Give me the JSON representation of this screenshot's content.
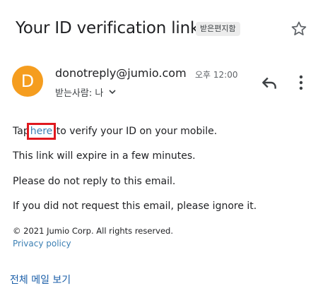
{
  "email": {
    "subject": "Your ID verification link",
    "label_badge": "받은편지함",
    "sender": "donotreply@jumio.com",
    "time": "오후 12:00",
    "avatar_letter": "D",
    "recipient": "받는사람: 나",
    "body": {
      "tap": "Tap",
      "here": "here",
      "verify_rest": "to verify your ID on your mobile.",
      "expire": "This link will expire in a few minutes.",
      "no_reply": "Please do not reply to this email.",
      "ignore": "If you did not request this email, please ignore it."
    },
    "copyright": "© 2021 Jumio Corp. All rights reserved.",
    "privacy": "Privacy policy",
    "view_all": "전체 메일 보기"
  },
  "colors": {
    "avatar": "#f59d1f",
    "link": "#3b7fb3",
    "highlight_box": "#e0191f"
  },
  "icons": [
    "star-icon",
    "reply-icon",
    "more-vert-icon",
    "chevron-down-icon"
  ]
}
